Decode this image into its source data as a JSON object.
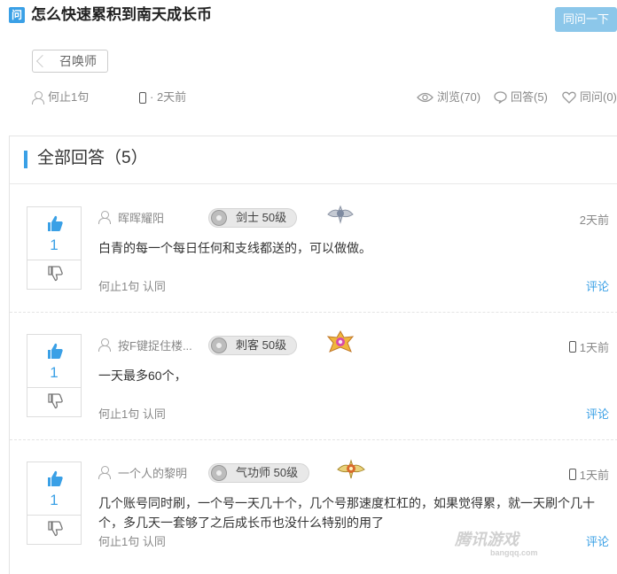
{
  "question": {
    "badge": "问",
    "title": "怎么快速累积到南天成长币",
    "ask_button": "同问一下",
    "tag": "召唤师",
    "author": "何止1句",
    "time": "· 2天前",
    "views": "浏览(70)",
    "answers": "回答(5)",
    "same_ask": "同问(0)"
  },
  "answers_section": {
    "title": "全部回答（5）"
  },
  "answers": [
    {
      "votes": "1",
      "user": "晖晖耀阳",
      "level": "剑士 50级",
      "time": "2天前",
      "has_phone": false,
      "body": "白青的每一个每日任何和支线都送的，可以做做。",
      "foot": "何止1句 认同",
      "comment": "评论"
    },
    {
      "votes": "1",
      "user": "按F键捉住楼...",
      "level": "刺客 50级",
      "time": "1天前",
      "has_phone": true,
      "body": "一天最多60个，",
      "foot": "何止1句 认同",
      "comment": "评论"
    },
    {
      "votes": "1",
      "user": "一个人的黎明",
      "level": "气功师 50级",
      "time": "1天前",
      "has_phone": true,
      "body": "几个账号同时刷，一个号一天几十个，几个号那速度杠杠的，如果觉得累，就一天刷个几十个，多几天一套够了之后成长币也没什么特别的用了",
      "foot": "何止1句 认同",
      "comment": "评论"
    }
  ],
  "watermark": {
    "main": "腾讯游戏",
    "sub": "bangqq.com"
  },
  "colors": {
    "accent": "#3aa0e6",
    "ask_button": "#8cc7ea"
  }
}
